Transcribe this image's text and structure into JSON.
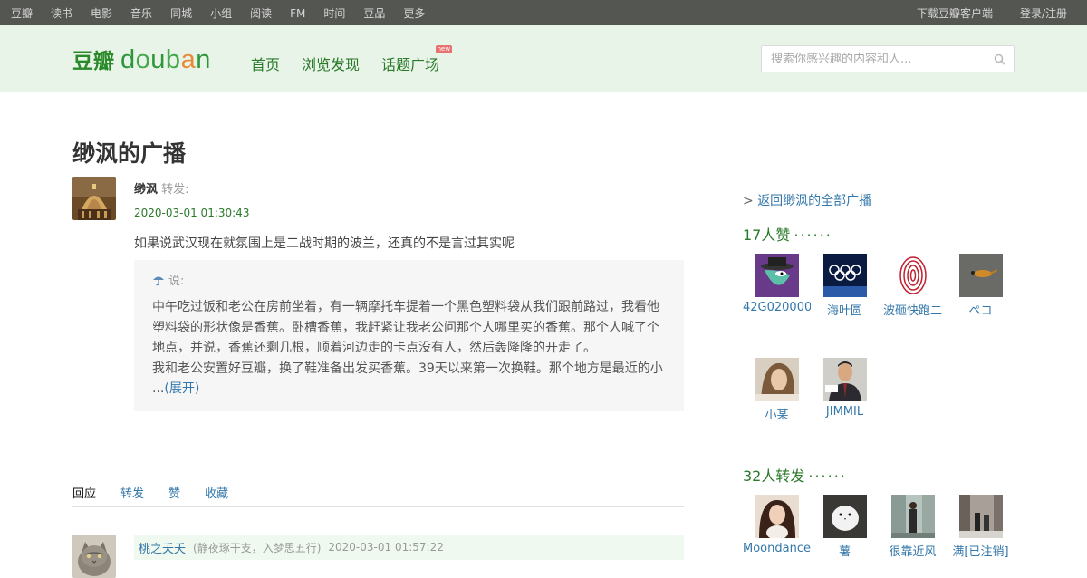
{
  "topnav": {
    "left": [
      "豆瓣",
      "读书",
      "电影",
      "音乐",
      "同城",
      "小组",
      "阅读",
      "FM",
      "时间",
      "豆品",
      "更多"
    ],
    "right": [
      "下载豆瓣客户端",
      "登录/注册"
    ]
  },
  "header": {
    "logo_cn": "豆瓣",
    "logo_en": [
      "d",
      "o",
      "u",
      "b",
      "a",
      "n"
    ],
    "nav": [
      "首页",
      "浏览发现",
      "话题广场"
    ],
    "new_tag": "new",
    "search_placeholder": "搜索你感兴趣的内容和人..."
  },
  "page_title": "缈沨的广播",
  "status": {
    "user": "缈沨",
    "action": "转发:",
    "time": "2020-03-01 01:30:43",
    "text": "如果说武汉现在就氛围上是二战时期的波兰，还真的不是言过其实呢",
    "quote": {
      "says": "说:",
      "lines": [
        "中午吃过饭和老公在房前坐着，有一辆摩托车提着一个黑色塑料袋从我们跟前路过，我看他",
        "塑料袋的形状像是香蕉。卧槽香蕉，我赶紧让我老公问那个人哪里买的香蕉。那个人喊了个",
        "地点，并说，香蕉还剩几根，顺着河边走的卡点没有人，然后轰隆隆的开走了。",
        "我和老公安置好豆瓣，换了鞋准备出发买香蕉。39天以来第一次换鞋。那个地方是最近的小"
      ],
      "ellipsis": "...",
      "expand": "(展开)"
    }
  },
  "tabs": [
    "回应",
    "转发",
    "赞",
    "收藏"
  ],
  "reply": {
    "name": "桃之夭夭",
    "signature": "(静夜琢干支，入梦思五行)",
    "time": "2020-03-01 01:57:22"
  },
  "sidebar": {
    "back_arrow": ">",
    "back_link": "返回缈沨的全部广播",
    "likes_title": "17人赞",
    "likes_dots": "······",
    "likers": [
      "42G020000",
      "海叶圆",
      "波砸快跑二",
      "ペコ",
      "小某",
      "JIMMIL"
    ],
    "reshares_title": "32人转发",
    "reshares_dots": "······",
    "resharers": [
      "Moondance",
      "薯",
      "很靠近风",
      "满[已注销]"
    ]
  },
  "colors": {
    "topbar": "#545652",
    "header": "#e9f4e9",
    "green": "#2a7a2a",
    "link": "#3377aa"
  }
}
